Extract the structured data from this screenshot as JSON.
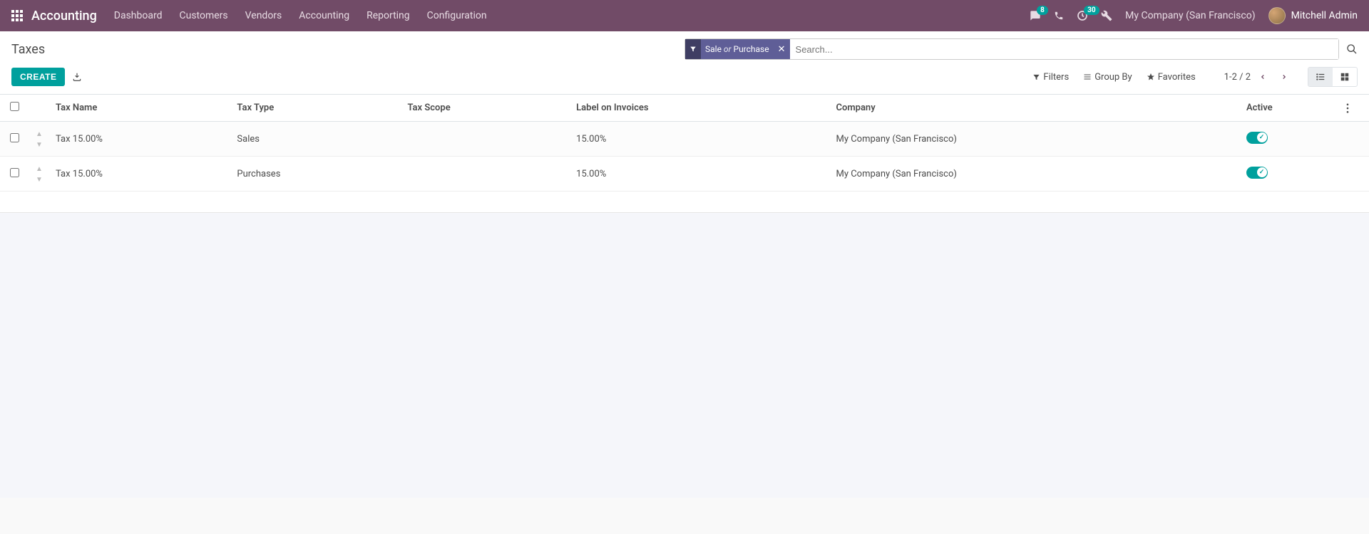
{
  "navbar": {
    "brand": "Accounting",
    "menu": [
      "Dashboard",
      "Customers",
      "Vendors",
      "Accounting",
      "Reporting",
      "Configuration"
    ],
    "messages_badge": "8",
    "activities_badge": "30",
    "company": "My Company (San Francisco)",
    "user": "Mitchell Admin"
  },
  "breadcrumb": "Taxes",
  "search": {
    "facet_prefix": "Sale",
    "facet_or": "or",
    "facet_suffix": "Purchase",
    "placeholder": "Search..."
  },
  "buttons": {
    "create": "Create",
    "filters": "Filters",
    "group_by": "Group By",
    "favorites": "Favorites"
  },
  "pager": {
    "range": "1-2 / 2"
  },
  "columns": {
    "name": "Tax Name",
    "type": "Tax Type",
    "scope": "Tax Scope",
    "label": "Label on Invoices",
    "company": "Company",
    "active": "Active"
  },
  "rows": [
    {
      "name": "Tax 15.00%",
      "type": "Sales",
      "scope": "",
      "label": "15.00%",
      "company": "My Company (San Francisco)",
      "active": true
    },
    {
      "name": "Tax 15.00%",
      "type": "Purchases",
      "scope": "",
      "label": "15.00%",
      "company": "My Company (San Francisco)",
      "active": true
    }
  ]
}
